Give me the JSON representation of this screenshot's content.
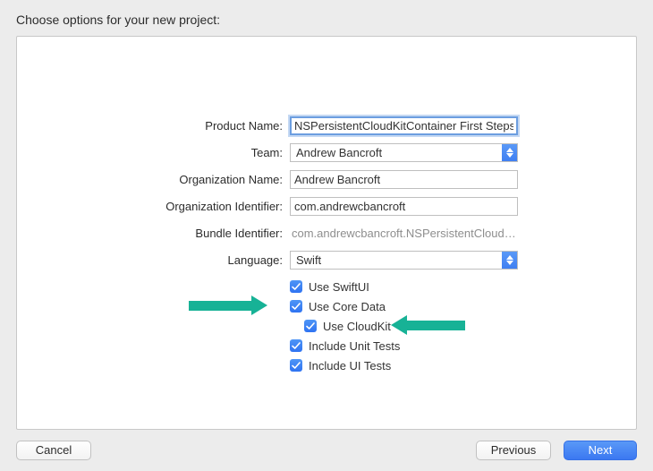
{
  "title": "Choose options for your new project:",
  "labels": {
    "product_name": "Product Name:",
    "team": "Team:",
    "org_name": "Organization Name:",
    "org_id": "Organization Identifier:",
    "bundle_id": "Bundle Identifier:",
    "language": "Language:"
  },
  "values": {
    "product_name": "NSPersistentCloudKitContainer First Steps",
    "team": "Andrew Bancroft",
    "org_name": "Andrew Bancroft",
    "org_id": "com.andrewcbancroft",
    "bundle_id": "com.andrewcbancroft.NSPersistentCloudKitCo...",
    "language": "Swift"
  },
  "checkboxes": {
    "swiftui": "Use SwiftUI",
    "coredata": "Use Core Data",
    "cloudkit": "Use CloudKit",
    "unittests": "Include Unit Tests",
    "uitests": "Include UI Tests"
  },
  "buttons": {
    "cancel": "Cancel",
    "previous": "Previous",
    "next": "Next"
  }
}
